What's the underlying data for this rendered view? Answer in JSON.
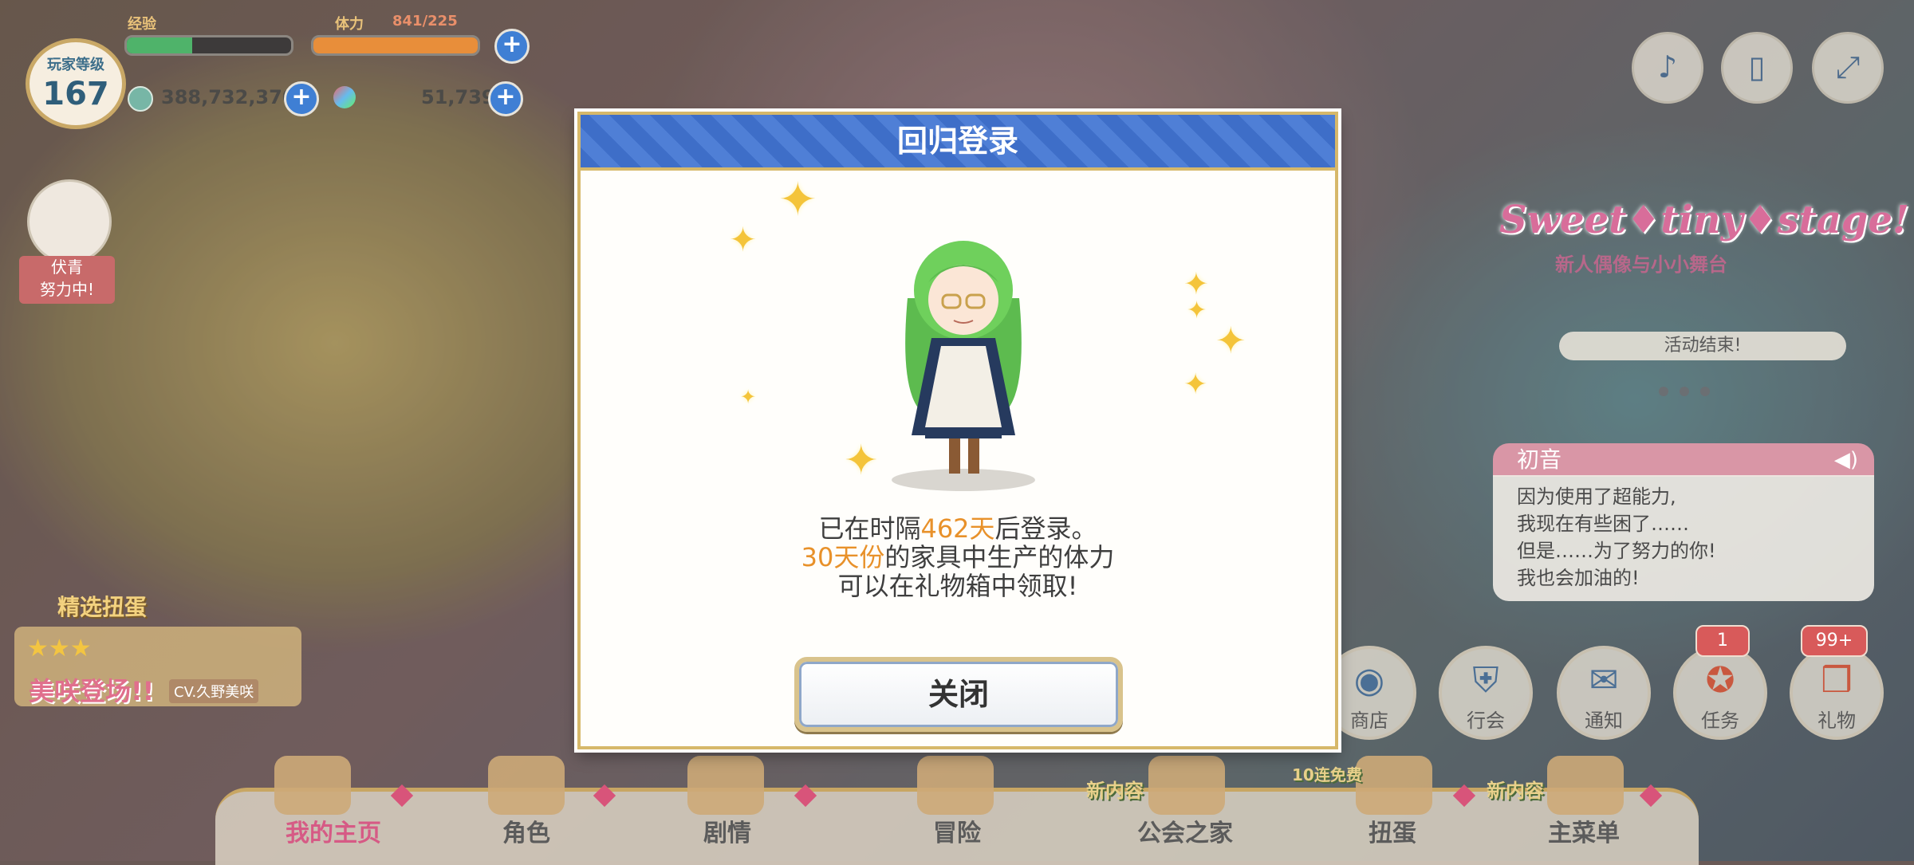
{
  "player": {
    "level_label": "玩家等级",
    "level": "167",
    "exp_label": "经验",
    "stamina_label": "体力",
    "stamina": "841/225",
    "mana": "388,732,370",
    "jewels": "51,739"
  },
  "top_icons": [
    "bell-icon",
    "book-icon",
    "fullscreen-icon"
  ],
  "side_badge": {
    "title": "伏青",
    "sub": "努力中!"
  },
  "gacha": {
    "label": "精选扭蛋",
    "title": "美咲登场!!",
    "cv": "CV.久野美咲",
    "stars": "★★★"
  },
  "event": {
    "title": "Sweet♦tiny♦stage!",
    "sub": "新人偶像与小小舞台",
    "status": "活动结束!"
  },
  "speech": {
    "speaker": "初音",
    "lines": [
      "因为使用了超能力,",
      "我现在有些困了……",
      "但是……为了努力的你!",
      "我也会加油的!"
    ]
  },
  "right_buttons": [
    {
      "label": "商店",
      "icon": "shop-icon"
    },
    {
      "label": "行会",
      "icon": "shield-icon"
    },
    {
      "label": "通知",
      "icon": "letter-icon"
    },
    {
      "label": "任务",
      "icon": "medal-icon",
      "counter": "1"
    },
    {
      "label": "礼物",
      "icon": "gift-icon",
      "counter": "99+"
    }
  ],
  "nav": [
    {
      "label": "我的主页"
    },
    {
      "label": "角色"
    },
    {
      "label": "剧情"
    },
    {
      "label": "冒险",
      "tag": "新内容"
    },
    {
      "label": "公会之家"
    },
    {
      "label": "扭蛋",
      "tag": "10连免费"
    },
    {
      "label": "主菜单",
      "tag": "新内容"
    }
  ],
  "modal": {
    "title": "回归登录",
    "line1_prefix": "已在时隔",
    "line1_highlight": "462天",
    "line1_suffix": "后登录。",
    "line2_highlight": "30天份",
    "line2_suffix": "的家具中生产的体力",
    "line3": "可以在礼物箱中领取!",
    "close_label": "关闭"
  },
  "colors": {
    "accent": "#3e6ec8",
    "highlight": "#e8912a",
    "gold": "#d6b86a"
  }
}
